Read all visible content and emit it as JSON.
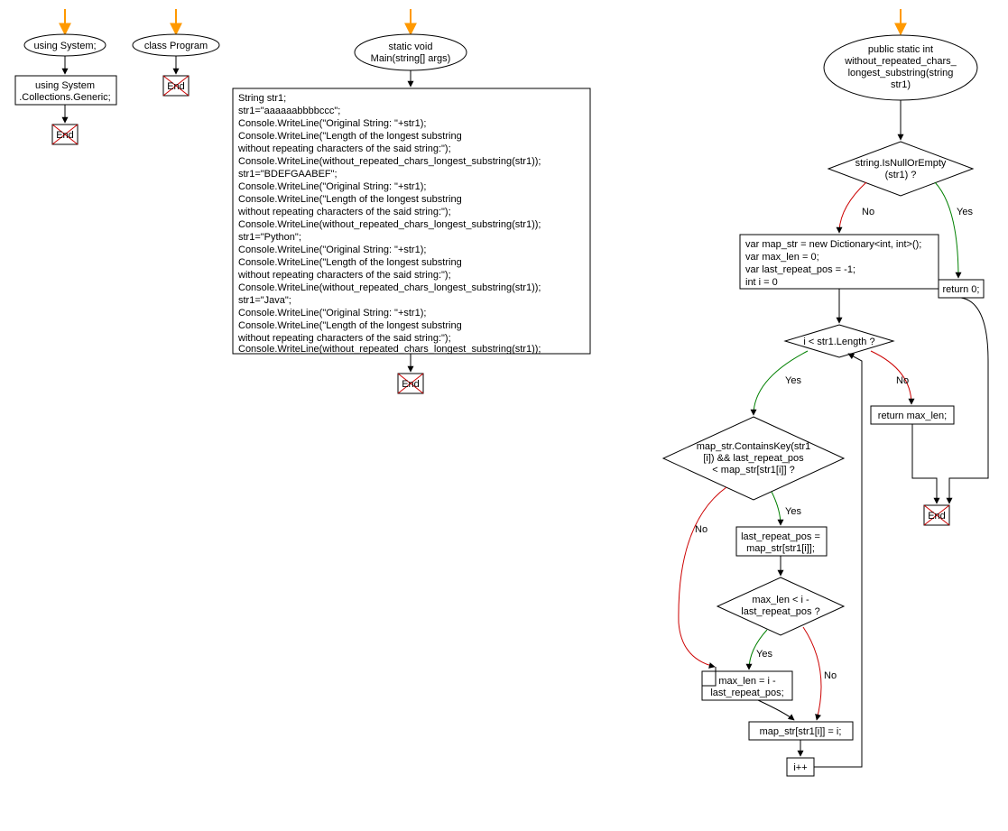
{
  "flow1": {
    "header": "using System;",
    "box": [
      "using System",
      ".Collections.Generic;"
    ],
    "end": "End"
  },
  "flow2": {
    "header": "class Program",
    "end": "End"
  },
  "flow3": {
    "header": [
      "static void",
      "Main(string[] args)"
    ],
    "body": [
      "String str1;",
      "str1=\"aaaaaabbbbccc\";",
      "Console.WriteLine(\"Original String: \"+str1);",
      "Console.WriteLine(\"Length of the longest substring",
      "without repeating characters of the said string:\");",
      "Console.WriteLine(without_repeated_chars_longest_substring(str1));",
      "str1=\"BDEFGAABEF\";",
      "Console.WriteLine(\"Original String: \"+str1);",
      "Console.WriteLine(\"Length of the longest substring",
      "without repeating characters of the said string:\");",
      "Console.WriteLine(without_repeated_chars_longest_substring(str1));",
      "str1=\"Python\";",
      "Console.WriteLine(\"Original String: \"+str1);",
      "Console.WriteLine(\"Length of the longest substring",
      "without repeating characters of the said string:\");",
      "Console.WriteLine(without_repeated_chars_longest_substring(str1));",
      "str1=\"Java\";",
      "Console.WriteLine(\"Original String: \"+str1);",
      "Console.WriteLine(\"Length of the longest substring",
      "without repeating characters of the said string:\");",
      "Console.WriteLine(without_repeated_chars_longest_substring(str1));"
    ],
    "end": "End"
  },
  "flow4": {
    "header": [
      "public static int",
      "without_repeated_chars_",
      "longest_substring(string",
      "str1)"
    ],
    "decision1": [
      "string.IsNullOrEmpty",
      "(str1) ?"
    ],
    "yes": "Yes",
    "no": "No",
    "init": [
      "var map_str = new Dictionary<int, int>();",
      "var max_len = 0;",
      "var last_repeat_pos = -1;",
      "int i = 0"
    ],
    "return0": "return 0;",
    "loopCond": "i < str1.Length ?",
    "returnMax": "return max_len;",
    "decision2": [
      "map_str.ContainsKey(str1",
      "[i]) && last_repeat_pos",
      "< map_str[str1[i]] ?"
    ],
    "assign1": [
      "last_repeat_pos =",
      "map_str[str1[i]];"
    ],
    "decision3": [
      "max_len < i -",
      "last_repeat_pos ?"
    ],
    "assign2": [
      "max_len = i -",
      "last_repeat_pos;"
    ],
    "assign3": "map_str[str1[i]] = i;",
    "increment": "i++",
    "end": "End"
  }
}
